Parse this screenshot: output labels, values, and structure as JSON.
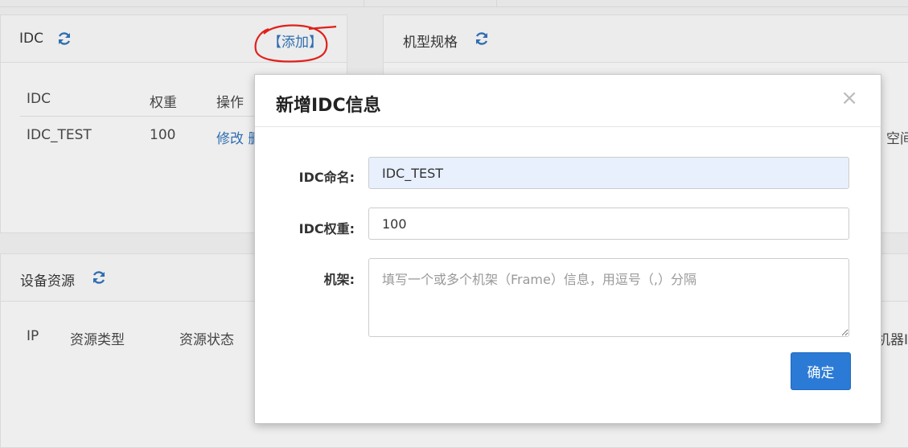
{
  "idc_panel": {
    "title": "IDC",
    "add_link": "【添加】",
    "columns": [
      "IDC",
      "权重",
      "操作"
    ],
    "rows": [
      {
        "name": "IDC_TEST",
        "weight": "100",
        "actions": "修改 删"
      }
    ]
  },
  "spec_panel": {
    "title": "机型规格",
    "partial_text": "空间"
  },
  "device_panel": {
    "title": "设备资源",
    "columns": [
      "IP",
      "资源类型",
      "资源状态"
    ],
    "partial_text": "机器IP"
  },
  "modal": {
    "title": "新增IDC信息",
    "close": "×",
    "fields": {
      "name_label": "IDC命名:",
      "name_value": "IDC_TEST",
      "weight_label": "IDC权重:",
      "weight_value": "100",
      "rack_label": "机架:",
      "rack_placeholder": "填写一个或多个机架（Frame）信息，用逗号（,）分隔"
    },
    "confirm_label": "确定"
  },
  "colors": {
    "accent": "#2b7bd6",
    "link": "#2f6db0",
    "annotation": "#e0201b"
  },
  "icons": [
    "refresh-icon",
    "close-icon",
    "resize-handle-icon"
  ]
}
